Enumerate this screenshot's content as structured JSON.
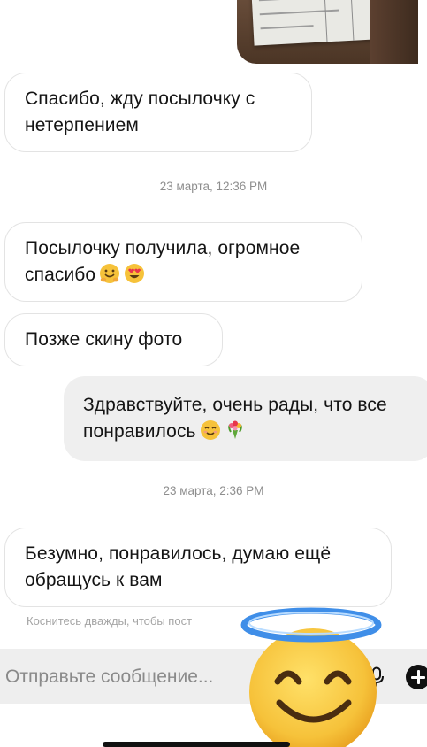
{
  "messages": [
    {
      "id": "m1",
      "direction": "in",
      "text": "Спасибо, жду посылочку с нетерпением"
    },
    {
      "id": "m2",
      "direction": "in",
      "text": "Посылочку получила, огромное спасибо",
      "emojis": [
        "hugging-face-emoji",
        "heart-eyes-emoji"
      ]
    },
    {
      "id": "m3",
      "direction": "in",
      "text": "Позже скину фото"
    },
    {
      "id": "m4",
      "direction": "out",
      "text": "Здравствуйте, очень рады, что все понравилось",
      "emojis": [
        "smiling-face-emoji",
        "bouquet-emoji"
      ]
    },
    {
      "id": "m5",
      "direction": "in",
      "text": "Безумно, понравилось, думаю ещё обращусь к вам"
    }
  ],
  "timestamps": [
    "23 марта, 12:36 PM",
    "23 марта, 2:36 PM"
  ],
  "hint": "Коснитесь дважды, чтобы пост",
  "composer": {
    "placeholder": "Отправьте сообщение...",
    "mic_icon": "microphone-icon",
    "plus_icon": "plus-icon"
  },
  "sticker": "smiling-face-with-halo-emoji",
  "colors": {
    "incoming_bubble_border": "#e3e3e3",
    "outgoing_bubble_bg": "#efefef",
    "timestamp": "#8e8e8e",
    "composer_bg": "#eeeeee",
    "halo": "#3f8ee8",
    "emoji_face": "#f6c23a"
  }
}
